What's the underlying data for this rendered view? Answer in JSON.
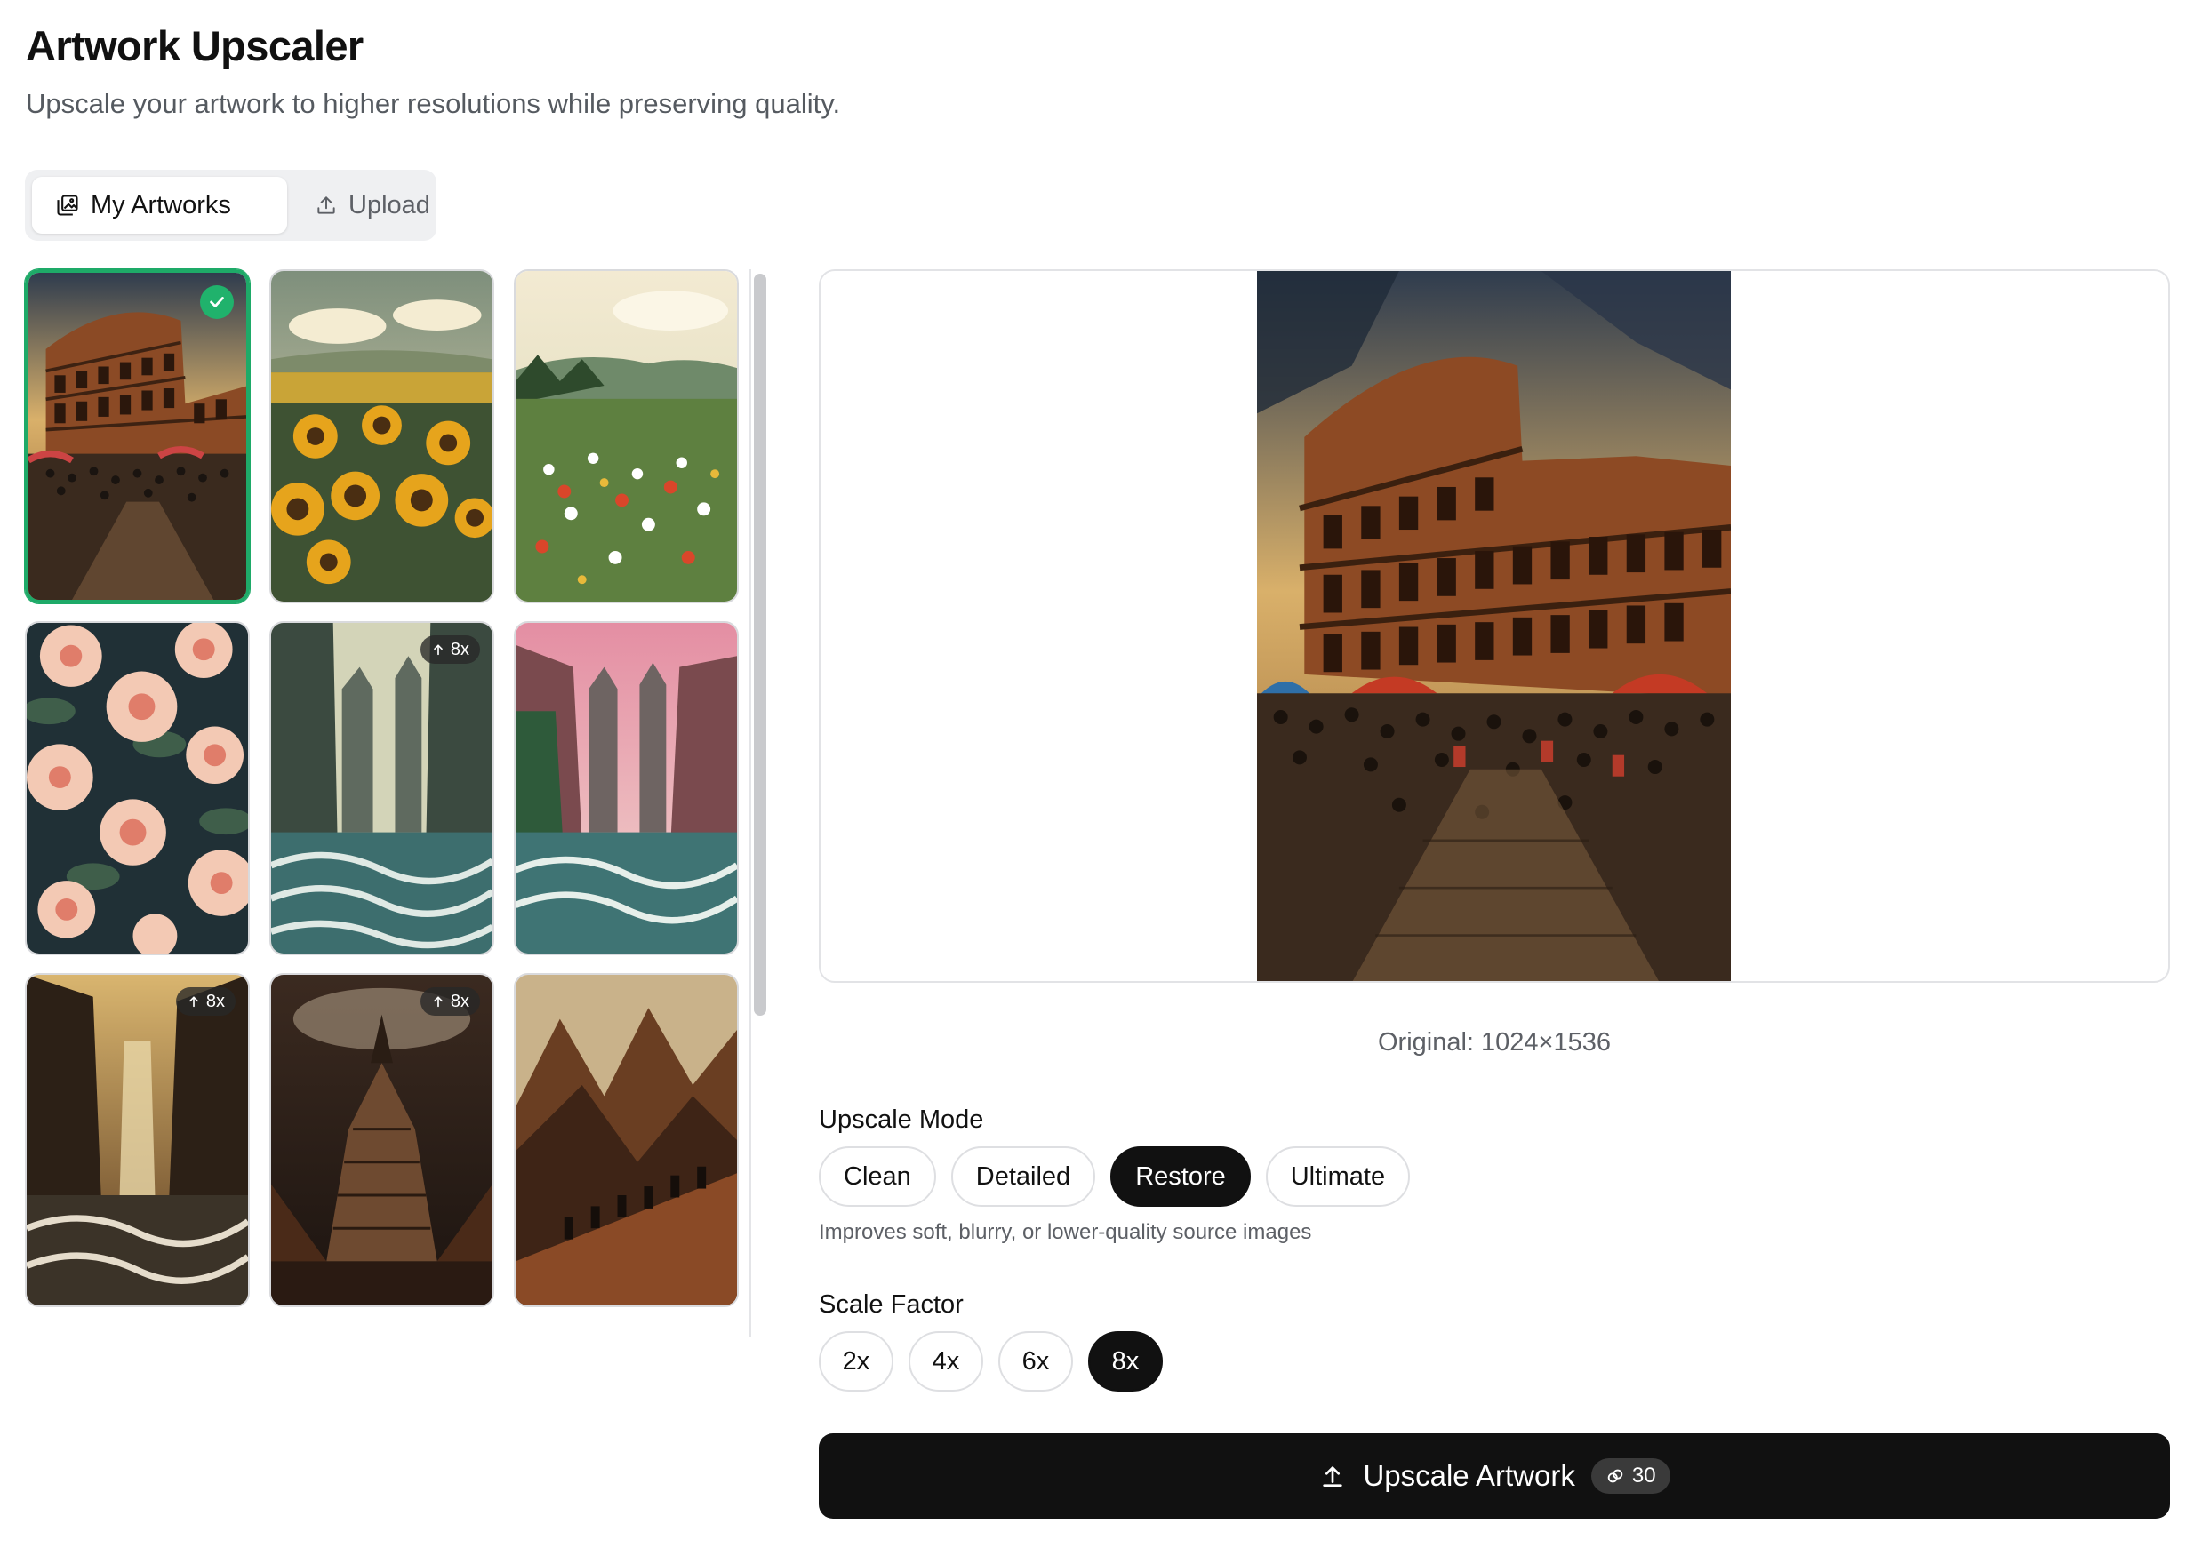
{
  "header": {
    "title": "Artwork Upscaler",
    "subtitle": "Upscale your artwork to higher resolutions while preserving quality."
  },
  "tabs": [
    {
      "label": "My Artworks",
      "icon": "images-icon",
      "active": true
    },
    {
      "label": "Upload",
      "icon": "upload-icon",
      "active": false
    }
  ],
  "gallery": {
    "items": [
      {
        "subject": "colosseum",
        "selected": true,
        "badge": ""
      },
      {
        "subject": "sunflowers",
        "selected": false,
        "badge": ""
      },
      {
        "subject": "wildflower-meadow",
        "selected": false,
        "badge": ""
      },
      {
        "subject": "peonies",
        "selected": false,
        "badge": ""
      },
      {
        "subject": "canyon-statues",
        "selected": false,
        "badge": "8x"
      },
      {
        "subject": "canyon-statues-pink",
        "selected": false,
        "badge": ""
      },
      {
        "subject": "waterfall-canyon",
        "selected": false,
        "badge": "8x"
      },
      {
        "subject": "mountain-citadel",
        "selected": false,
        "badge": "8x"
      },
      {
        "subject": "mountain-travelers",
        "selected": false,
        "badge": ""
      }
    ]
  },
  "preview": {
    "subject": "colosseum",
    "original_label": "Original: 1024×1536"
  },
  "upscale_mode": {
    "label": "Upscale Mode",
    "options": [
      "Clean",
      "Detailed",
      "Restore",
      "Ultimate"
    ],
    "selected": "Restore",
    "hint": "Improves soft, blurry, or lower-quality source images"
  },
  "scale_factor": {
    "label": "Scale Factor",
    "options": [
      "2x",
      "4x",
      "6x",
      "8x"
    ],
    "selected": "8x"
  },
  "action": {
    "label": "Upscale Artwork",
    "credits": "30"
  },
  "colors": {
    "accent_green": "#1eaa68",
    "primary_black": "#111111"
  }
}
